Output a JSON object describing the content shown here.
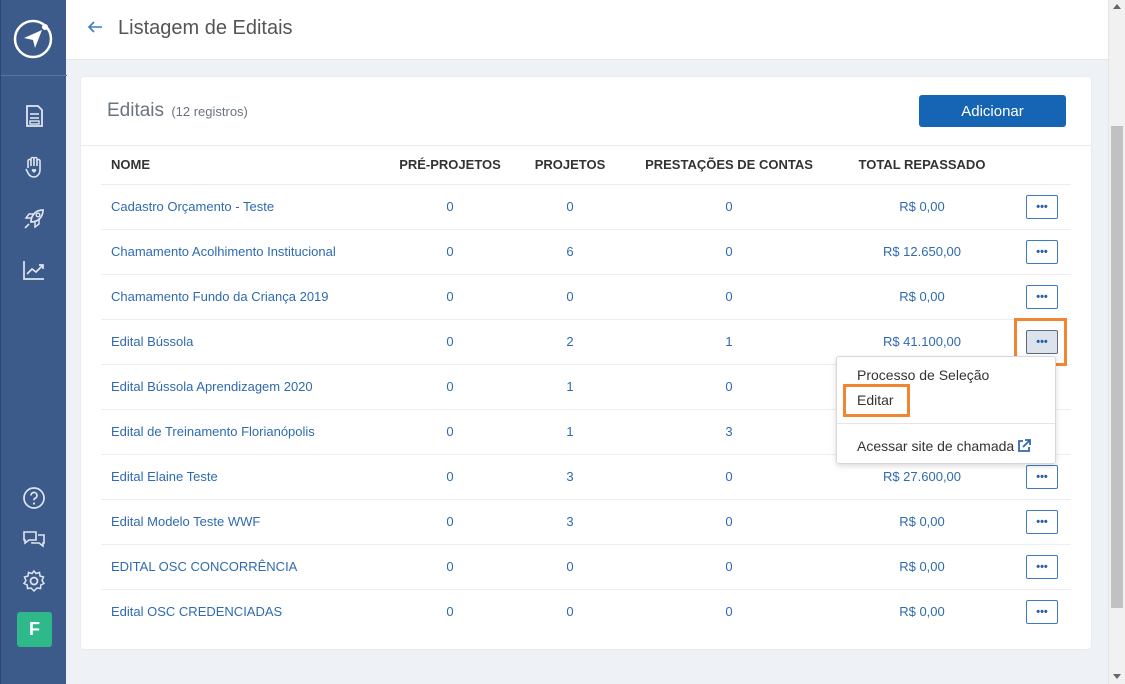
{
  "header": {
    "title": "Listagem de Editais"
  },
  "card": {
    "title": "Editais",
    "count": "(12 registros)",
    "add_button": "Adicionar"
  },
  "table": {
    "columns": [
      "NOME",
      "PRÉ-PROJETOS",
      "PROJETOS",
      "PRESTAÇÕES DE CONTAS",
      "TOTAL REPASSADO"
    ],
    "rows": [
      {
        "nome": "Cadastro Orçamento - Teste",
        "pre_projetos": "0",
        "projetos": "0",
        "prestacoes": "0",
        "total": "R$ 0,00",
        "actions": "•••"
      },
      {
        "nome": "Chamamento Acolhimento Institucional",
        "pre_projetos": "0",
        "projetos": "6",
        "prestacoes": "0",
        "total": "R$ 12.650,00",
        "actions": "•••"
      },
      {
        "nome": "Chamamento Fundo da Criança 2019",
        "pre_projetos": "0",
        "projetos": "0",
        "prestacoes": "0",
        "total": "R$ 0,00",
        "actions": "•••"
      },
      {
        "nome": "Edital Bússola",
        "pre_projetos": "0",
        "projetos": "2",
        "prestacoes": "1",
        "total": "R$ 41.100,00",
        "actions": "•••"
      },
      {
        "nome": "Edital Bússola Aprendizagem 2020",
        "pre_projetos": "0",
        "projetos": "1",
        "prestacoes": "0",
        "total": "",
        "actions": ""
      },
      {
        "nome": "Edital de Treinamento Florianópolis",
        "pre_projetos": "0",
        "projetos": "1",
        "prestacoes": "3",
        "total": "",
        "actions": ""
      },
      {
        "nome": "Edital Elaine Teste",
        "pre_projetos": "0",
        "projetos": "3",
        "prestacoes": "0",
        "total": "R$ 27.600,00",
        "actions": "•••"
      },
      {
        "nome": "Edital Modelo Teste WWF",
        "pre_projetos": "0",
        "projetos": "3",
        "prestacoes": "0",
        "total": "R$ 0,00",
        "actions": "•••"
      },
      {
        "nome": "EDITAL OSC CONCORRÊNCIA",
        "pre_projetos": "0",
        "projetos": "0",
        "prestacoes": "0",
        "total": "R$ 0,00",
        "actions": "•••"
      },
      {
        "nome": "Edital OSC CREDENCIADAS",
        "pre_projetos": "0",
        "projetos": "0",
        "prestacoes": "0",
        "total": "R$ 0,00",
        "actions": "•••"
      }
    ]
  },
  "dropdown": {
    "items": [
      "Processo de Seleção",
      "Editar",
      "Acessar site de chamada"
    ]
  },
  "sidebar": {
    "avatar_letter": "F",
    "icons": [
      "logo-icon",
      "document-icon",
      "hand-heart-icon",
      "rocket-icon",
      "chart-icon",
      "help-icon",
      "chat-icon",
      "settings-icon"
    ]
  },
  "colors": {
    "sidebar": "#3c5a8a",
    "primary": "#1565b4",
    "link": "#2f6ab0",
    "highlight": "#f08532",
    "avatar": "#2fb889"
  }
}
